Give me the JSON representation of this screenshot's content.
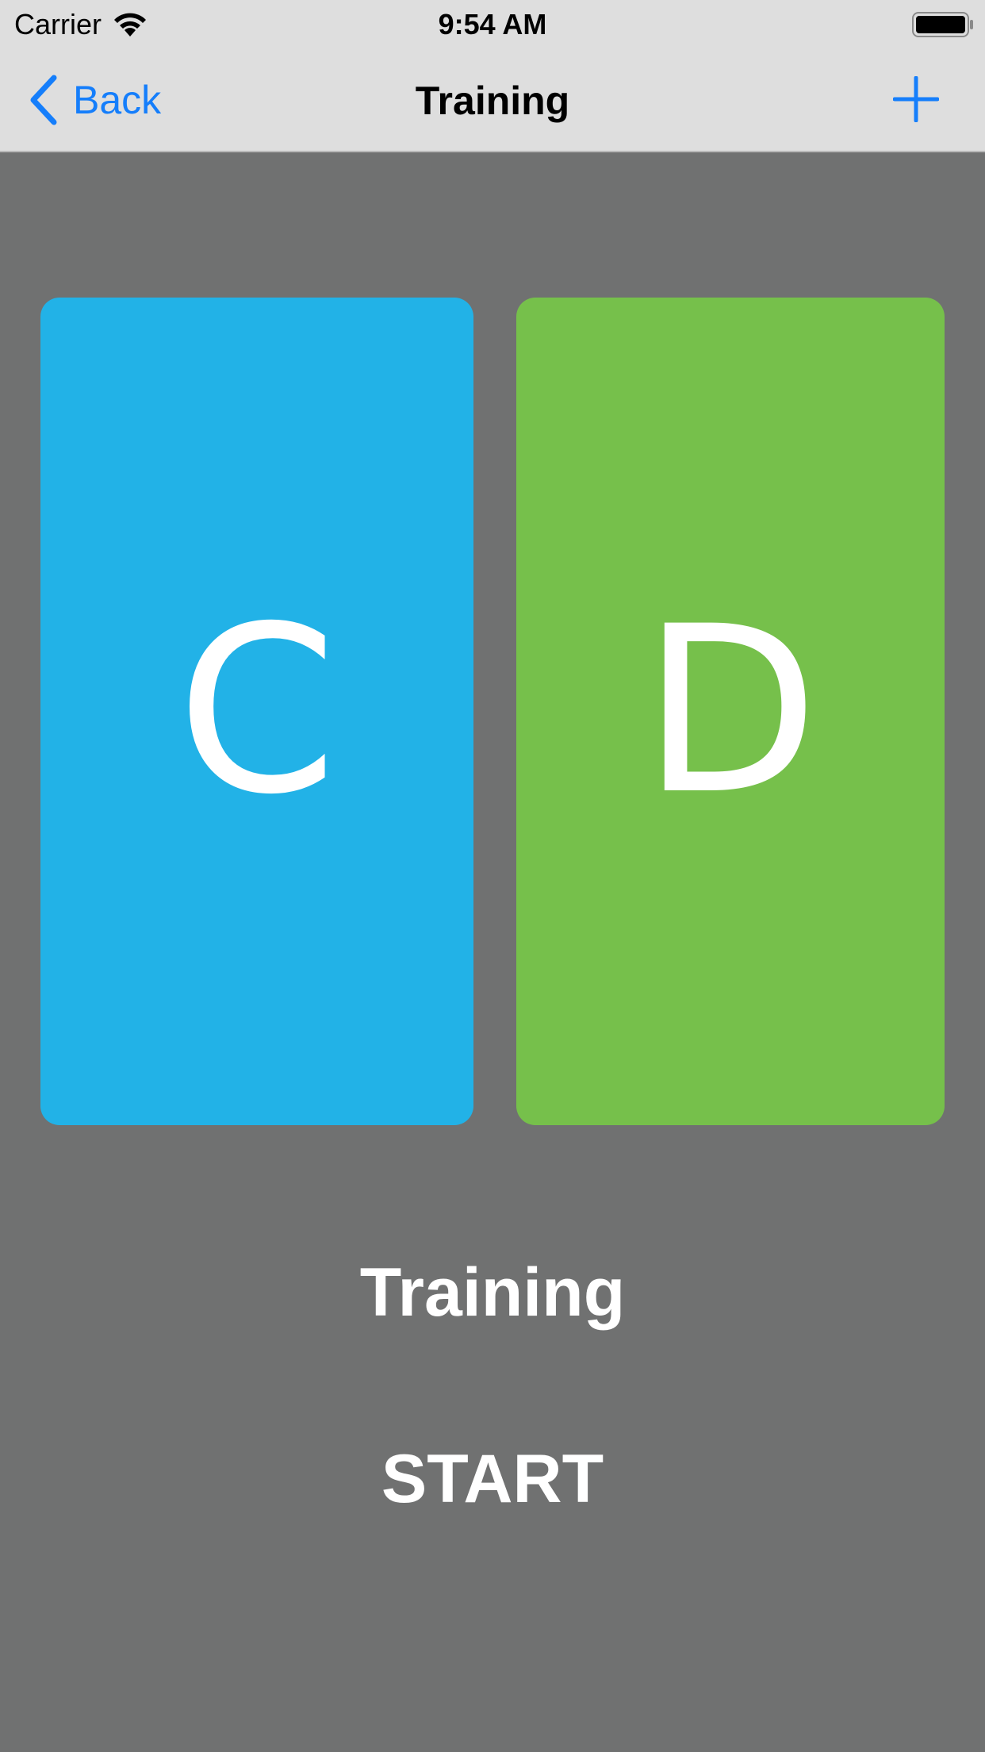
{
  "status_bar": {
    "carrier": "Carrier",
    "time": "9:54 AM"
  },
  "nav_bar": {
    "back_label": "Back",
    "title": "Training",
    "add_icon": "plus-icon"
  },
  "cards": [
    {
      "letter": "C",
      "color": "#22b2e7"
    },
    {
      "letter": "D",
      "color": "#76c04b"
    }
  ],
  "mode_label": "Training",
  "start_label": "START",
  "colors": {
    "accent": "#157efb",
    "background": "#707171",
    "bar": "#dedede"
  }
}
